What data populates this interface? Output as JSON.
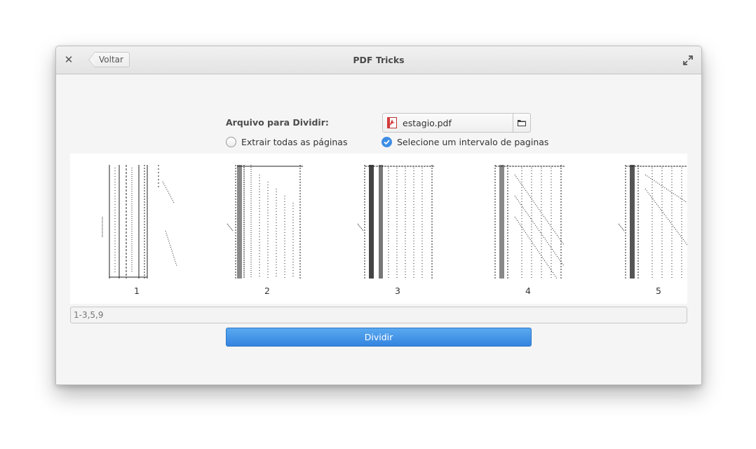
{
  "window": {
    "title": "PDF Tricks",
    "back_label": "Voltar"
  },
  "form": {
    "file_label": "Arquivo para Dividir:",
    "file_name": "estagio.pdf",
    "option_all": "Extrair todas as páginas",
    "option_range": "Selecione um intervalo de paginas",
    "selected_option": "range"
  },
  "pages": [
    {
      "number": "1"
    },
    {
      "number": "2"
    },
    {
      "number": "3"
    },
    {
      "number": "4"
    },
    {
      "number": "5"
    }
  ],
  "range_input": {
    "placeholder": "1-3,5,9"
  },
  "actions": {
    "divide_label": "Dividir"
  },
  "colors": {
    "accent": "#3d8de4",
    "button": "#3484e0",
    "pdf_icon": "#d23b3b"
  }
}
